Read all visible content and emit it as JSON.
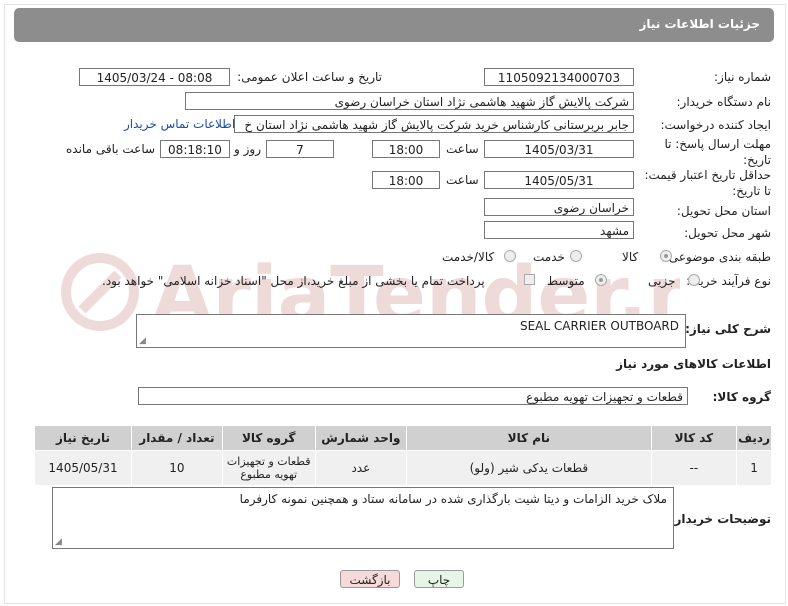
{
  "header": {
    "title": "جزئیات اطلاعات نیاز"
  },
  "labels": {
    "need_number": "شماره نیاز:",
    "announce_datetime": "تاریخ و ساعت اعلان عمومی:",
    "buyer_org": "نام دستگاه خریدار:",
    "requester": "ایجاد کننده درخواست:",
    "reply_deadline": "مهلت ارسال پاسخ: تا تاریخ:",
    "price_validity": "حداقل تاریخ اعتبار قیمت: تا تاریخ:",
    "delivery_province": "استان محل تحویل:",
    "delivery_city": "شهر محل تحویل:",
    "category": "طبقه بندی موضوعی:",
    "purchase_type": "نوع فرآیند خرید :",
    "hour": "ساعت",
    "day_and": "روز و",
    "remaining": "ساعت باقی مانده",
    "general_desc": "شرح کلی نیاز:",
    "goods_info": "اطلاعات کالاهای مورد نیاز",
    "goods_group": "گروه کالا:",
    "buyer_notes": "توضیحات خریدار:"
  },
  "values": {
    "need_number": "1105092134000703",
    "announce_datetime": "1405/03/24 - 08:08",
    "buyer_org": "شرکت پالایش گاز شهید هاشمی نژاد   استان خراسان رضوی",
    "requester": "جابر بربرستانی کارشناس خرید شرکت پالایش گاز شهید هاشمی نژاد   استان خ",
    "contact_link": "اطلاعات تماس خریدار",
    "reply_date": "1405/03/31",
    "reply_hour": "18:00",
    "reply_days": "7",
    "reply_remaining": "08:18:10",
    "price_date": "1405/05/31",
    "price_hour": "18:00",
    "delivery_province": "خراسان رضوی",
    "delivery_city": "مشهد",
    "general_desc": "SEAL CARRIER OUTBOARD",
    "goods_group": "قطعات و تجهیزات تهویه مطبوع",
    "buyer_notes": "ملاک خرید الزامات و دیتا شیت بارگذاری شده در سامانه ستاد و همچنین نمونه کارفرما"
  },
  "category_options": [
    {
      "label": "کالا",
      "selected": true
    },
    {
      "label": "خدمت",
      "selected": false
    },
    {
      "label": "کالا/خدمت",
      "selected": false
    }
  ],
  "purchase_options": [
    {
      "label": "جزیی",
      "selected": false
    },
    {
      "label": "متوسط",
      "selected": true
    }
  ],
  "payment_note": "پرداخت تمام یا بخشی از مبلغ خرید،از محل \"اسناد خزانه اسلامی\" خواهد بود.",
  "table": {
    "headers": [
      "ردیف",
      "کد کالا",
      "نام کالا",
      "واحد شمارش",
      "گروه کالا",
      "تعداد / مقدار",
      "تاریخ نیاز"
    ],
    "rows": [
      [
        "1",
        "--",
        "قطعات یدکی شیر (ولو)",
        "عدد",
        "قطعات و تجهیزات تهویه مطبوع",
        "10",
        "1405/05/31"
      ]
    ]
  },
  "buttons": {
    "print": "چاپ",
    "back": "بازگشت"
  },
  "watermark": {
    "text": "AriaTender.net"
  },
  "colors": {
    "header_bg": "#8d8d8d",
    "link": "#1a4ea8",
    "back_btn_bg": "#f6d9d9",
    "print_btn_bg": "#e6f5e6",
    "table_header": "#d0d0d0",
    "watermark": "#e2bcbc"
  }
}
